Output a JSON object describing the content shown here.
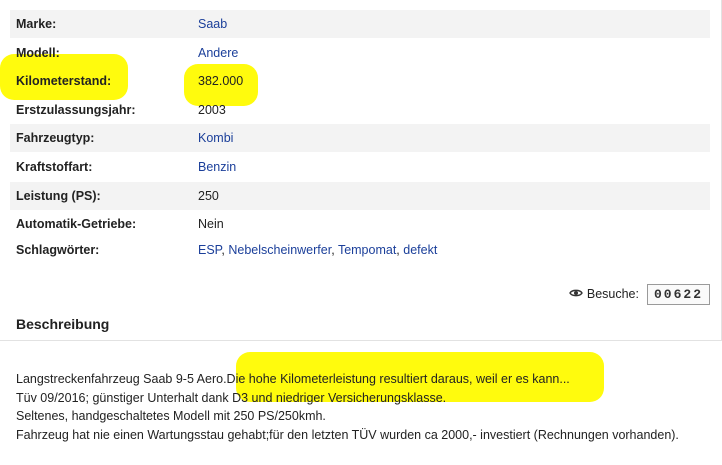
{
  "specs": [
    {
      "key": "Marke:",
      "value": "Saab",
      "link": true
    },
    {
      "key": "Modell:",
      "value": "Andere",
      "link": true
    },
    {
      "key": "Kilometerstand:",
      "value": "382.000",
      "link": false
    },
    {
      "key": "Erstzulassungsjahr:",
      "value": "2003",
      "link": false
    },
    {
      "key": "Fahrzeugtyp:",
      "value": "Kombi",
      "link": true
    },
    {
      "key": "Kraftstoffart:",
      "value": "Benzin",
      "link": true
    },
    {
      "key": "Leistung (PS):",
      "value": "250",
      "link": false
    },
    {
      "key": "Automatik-Getriebe:",
      "value": "Nein",
      "link": false
    },
    {
      "key": "Schlagwörter:",
      "tags": [
        "ESP",
        "Nebelscheinwerfer",
        "Tempomat",
        "defekt"
      ]
    }
  ],
  "visits": {
    "label": "Besuche:",
    "count": "00622",
    "icon": "eye-icon"
  },
  "description": {
    "title": "Beschreibung",
    "lines": [
      "Langstreckenfahrzeug Saab 9-5 Aero.Die hohe Kilometerleistung resultiert daraus, weil er es kann...",
      "Tüv 09/2016; günstiger Unterhalt dank D3 und niedriger Versicherungsklasse.",
      "Seltenes, handgeschaltetes Modell mit 250 PS/250kmh.",
      "Fahrzeug hat nie einen Wartungsstau gehabt;für den letzten TÜV wurden ca 2000,- investiert (Rechnungen vorhanden)."
    ]
  },
  "colors": {
    "link": "#1b3f9a",
    "highlight": "#fffb00",
    "row_alt": "#f3f3f3"
  }
}
